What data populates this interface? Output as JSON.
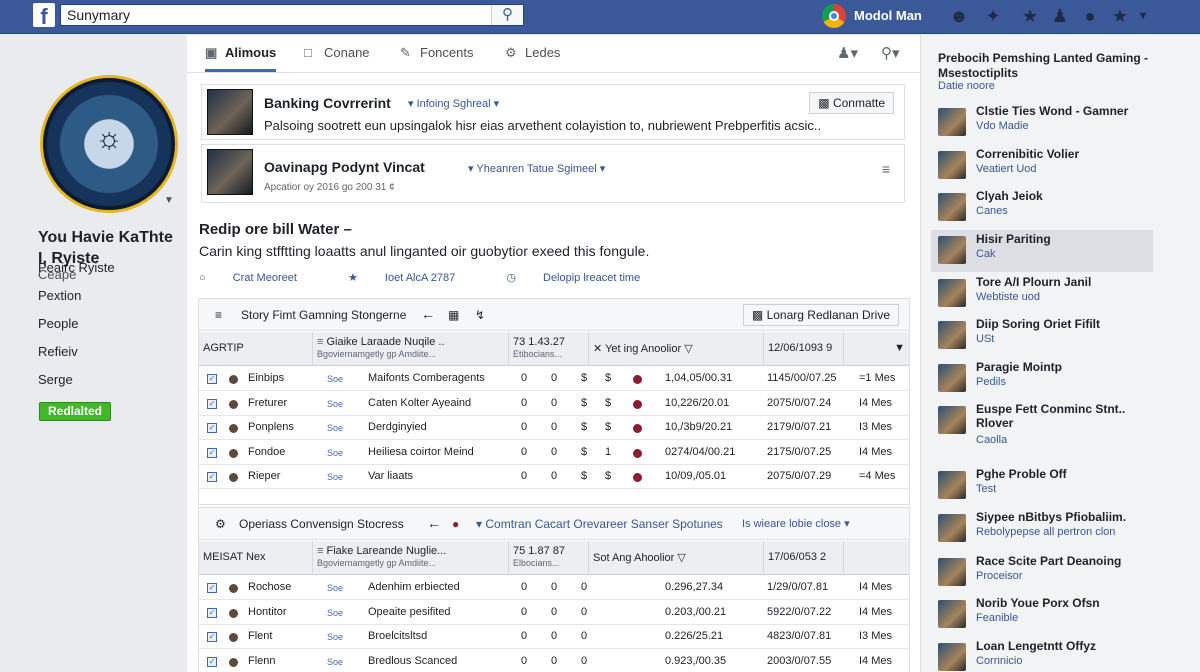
{
  "topbar": {
    "logo": "f",
    "search_value": "Sunymary",
    "user_name": "Modol Man"
  },
  "left": {
    "profile_name": "You Havie KaThte I, Ryiste",
    "profile_sub": "Ceape",
    "nav": [
      "Peairc Ryiste",
      "Pextion",
      "People",
      "Refieiv",
      "Serge"
    ],
    "button": "Redlalted"
  },
  "tabs": [
    "Alimous",
    "Conane",
    "Foncents",
    "Ledes"
  ],
  "cards": [
    {
      "title": "Banking Covrrerint",
      "pill": "Infoing Sghreal",
      "text": "Palsoing sootrett eun upsingalok hisr eias arvethent colayistion to, nubriewent Prebperfitis acsic..",
      "button": "Conmatte"
    },
    {
      "title": "Oavinapg Podynt Vincat",
      "pill": "Yheanren Tatue Sgimeel",
      "meta": "Apcatior oy 2016 go 200 31 ¢"
    }
  ],
  "post": {
    "title": "Redip ore bill Water –",
    "text": "Carin king stfftting loaatts anul linganted oir guobytior exeed this fongule.",
    "links": [
      "Crat Meoreet",
      "Ioet AlcA 2787",
      "Delopip lreacet time"
    ]
  },
  "panel1": {
    "title": "Story Fimt Gamning Stongerne",
    "button": "Lonarg Redlanan Drive",
    "headers": {
      "c1": "AGRTIP",
      "c2_main": "Giaike Laraade Nuqile ..",
      "c2_sub": "Bgoviernamgetly gp Amdiite...",
      "c3_main": "73 1.43.27",
      "c3_sub": "Etibocians...",
      "c4": "Yet ing Anoolior",
      "c5": "12/06/1093 9"
    },
    "rows": [
      {
        "name": "Einbips",
        "tag": "Soe",
        "desc": "Maifonts Comberagents",
        "a": "0",
        "b": "0",
        "s1": "$",
        "s2": "$",
        "date1": "1,04,05/00.31",
        "date2": "1145/00/07.25",
        "count": "=1 Mes"
      },
      {
        "name": "Freturer",
        "tag": "Soe",
        "desc": "Caten Kolter Ayeaind",
        "a": "0",
        "b": "0",
        "s1": "$",
        "s2": "$",
        "date1": "10,226/20.01",
        "date2": "2075/0/07.24",
        "count": "I4 Mes"
      },
      {
        "name": "Ponplens",
        "tag": "Soe",
        "desc": "Derdginyied",
        "a": "0",
        "b": "0",
        "s1": "$",
        "s2": "$",
        "date1": "10,/3b9/20.21",
        "date2": "2179/0/07.21",
        "count": "I3 Mes"
      },
      {
        "name": "Fondoe",
        "tag": "Soe",
        "desc": "Heiliesa coirtor Meind",
        "a": "0",
        "b": "0",
        "s1": "$",
        "s2": "1",
        "date1": "0274/04/00.21",
        "date2": "2175/0/07.25",
        "count": "I4 Mes"
      },
      {
        "name": "Rieper",
        "tag": "Soe",
        "desc": "Var liaats",
        "a": "0",
        "b": "0",
        "s1": "$",
        "s2": "$",
        "date1": "10/09,/05.01",
        "date2": "2075/0/07.29",
        "count": "=4 Mes"
      }
    ]
  },
  "panel2": {
    "title": "Operiass Convensign Stocress",
    "link": "Comtran Cacart Orevareer Sanser Spotunes",
    "note": "Is wieare lobie close",
    "headers": {
      "c1": "MEISAT Nex",
      "c2_main": "Fiake Lareande Nuglie...",
      "c2_sub": "Bgoviernamgetly gp Amdiite...",
      "c3_main": "75 1.87 87",
      "c3_sub": "Elbocians...",
      "c4": "Sot Ang Ahoolior",
      "c5": "17/06/053 2"
    },
    "rows": [
      {
        "name": "Rochose",
        "tag": "Soe",
        "desc": "Adenhim erbiected",
        "a": "0",
        "b": "0",
        "s1": "0",
        "date1": "0.296,27.34",
        "date2": "1/29/0/07.81",
        "count": "I4 Mes"
      },
      {
        "name": "Hontitor",
        "tag": "Soe",
        "desc": "Opeaite pesifited",
        "a": "0",
        "b": "0",
        "s1": "0",
        "date1": "0.203,/00.21",
        "date2": "5922/0/07.22",
        "count": "I4 Mes"
      },
      {
        "name": "Flent",
        "tag": "Soe",
        "desc": "Broelcitsltsd",
        "a": "0",
        "b": "0",
        "s1": "0",
        "date1": "0.226/25.21",
        "date2": "4823/0/07.81",
        "count": "I3 Mes"
      },
      {
        "name": "Flenn",
        "tag": "Soe",
        "desc": "Bredlous Scanced",
        "a": "0",
        "b": "0",
        "s1": "0",
        "date1": "0.923,/00.35",
        "date2": "2003/0/07.55",
        "count": "I4 Mes"
      }
    ]
  },
  "right": {
    "heading": "Prebocih Pemshing Lanted Gaming - Msestoctiplits",
    "sub": "Datie noore",
    "items": [
      {
        "name": "Clstie Ties Wond - Gamner",
        "sub": "Vdo Madie"
      },
      {
        "name": "Correnibitic Volier",
        "sub": "Veatiert Uod"
      },
      {
        "name": "Clyah Jeiok",
        "sub": "Canes"
      },
      {
        "name": "Hisir Pariting",
        "sub": "Cak"
      },
      {
        "name": "Tore A/I Plourn Janil",
        "sub": "Webtiste uod"
      },
      {
        "name": "Diip Soring Oriet Fifilt",
        "sub": "USt"
      },
      {
        "name": "Paragie Mointp",
        "sub": "Pedils"
      },
      {
        "name": "Euspe Fett Conminc Stnt.. Rlover",
        "sub": "Caolla"
      },
      {
        "name": "Pghe Proble Off",
        "sub": "Test"
      },
      {
        "name": "Siypee nBitbys Pfiobaliim.",
        "sub": "Rebolypepse all pertron clon"
      },
      {
        "name": "Race Scite Part Deanoing",
        "sub": "Proceisor"
      },
      {
        "name": "Norib Youe Porx Ofsn",
        "sub": "Feanible"
      },
      {
        "name": "Loan Lengetntt Offyz",
        "sub": "Cornnicio"
      }
    ]
  }
}
